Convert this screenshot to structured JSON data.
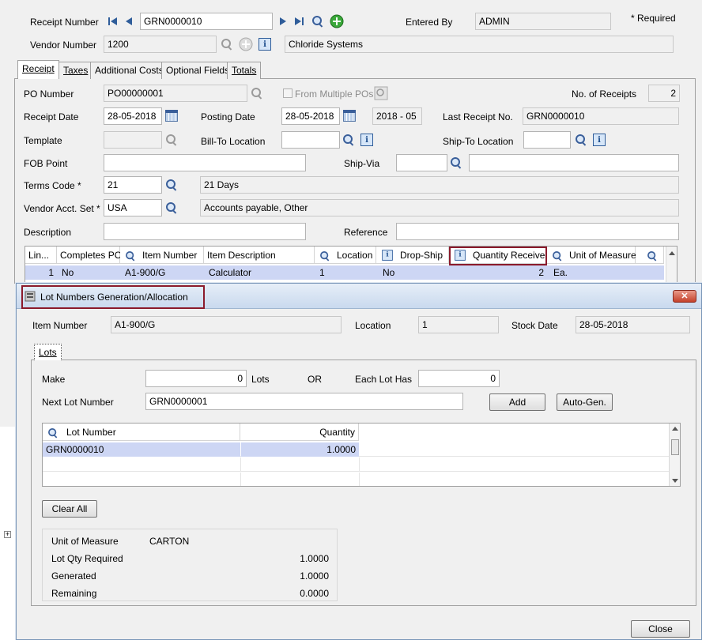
{
  "header": {
    "receipt_number_label": "Receipt Number",
    "receipt_number_value": "GRN0000010",
    "entered_by_label": "Entered By",
    "entered_by_value": "ADMIN",
    "required_note": "*  Required",
    "vendor_number_label": "Vendor Number",
    "vendor_number_value": "1200",
    "vendor_name_value": "Chloride Systems"
  },
  "tabs": [
    {
      "label": "Receipt",
      "active": true
    },
    {
      "label": "Taxes"
    },
    {
      "label": "Additional Costs"
    },
    {
      "label": "Optional Fields"
    },
    {
      "label": "Totals"
    }
  ],
  "receipt": {
    "po_number_label": "PO Number",
    "po_number_value": "PO00000001",
    "from_multiple_pos_label": "From Multiple POs",
    "no_of_receipts_label": "No. of Receipts",
    "no_of_receipts_value": "2",
    "receipt_date_label": "Receipt Date",
    "receipt_date_value": "28-05-2018",
    "posting_date_label": "Posting Date",
    "posting_date_value": "28-05-2018",
    "period_value": "2018 - 05",
    "last_receipt_no_label": "Last Receipt No.",
    "last_receipt_no_value": "GRN0000010",
    "template_label": "Template",
    "bill_to_label": "Bill-To Location",
    "ship_to_label": "Ship-To Location",
    "fob_label": "FOB Point",
    "ship_via_label": "Ship-Via",
    "terms_label": "Terms Code *",
    "terms_value": "21",
    "terms_desc": "21 Days",
    "vendor_acct_label": "Vendor Acct. Set *",
    "vendor_acct_value": "USA",
    "vendor_acct_desc": "Accounts payable, Other",
    "description_label": "Description",
    "reference_label": "Reference"
  },
  "lines_grid": {
    "headers": [
      "Lin...",
      "Completes PO",
      "Item Number",
      "Item Description",
      "Location",
      "Drop-Ship",
      "Quantity Received",
      "Unit of Measure"
    ],
    "rows": [
      {
        "line": "1",
        "completes_po": "No",
        "item_number": "A1-900/G",
        "item_description": "Calculator",
        "location": "1",
        "drop_ship": "No",
        "quantity_received": "2",
        "unit_of_measure": "Ea."
      }
    ]
  },
  "dialog": {
    "title": "Lot Numbers Generation/Allocation",
    "close_glyph": "✕",
    "item_number_label": "Item Number",
    "item_number_value": "A1-900/G",
    "location_label": "Location",
    "location_value": "1",
    "stock_date_label": "Stock Date",
    "stock_date_value": "28-05-2018",
    "tab_label": "Lots",
    "make_label": "Make",
    "make_value": "0",
    "lots_label": "Lots",
    "or_label": "OR",
    "each_lot_has_label": "Each Lot Has",
    "each_lot_has_value": "0",
    "next_lot_label": "Next Lot Number",
    "next_lot_value": "GRN0000001",
    "add_button": "Add",
    "autogen_button": "Auto-Gen.",
    "lot_grid": {
      "headers": [
        "Lot Number",
        "Quantity"
      ],
      "rows": [
        {
          "lot_number": "GRN0000010",
          "quantity": "1.0000"
        }
      ]
    },
    "clear_all_button": "Clear All",
    "summary": {
      "uom_label": "Unit of Measure",
      "uom_value": "CARTON",
      "lot_qty_required_label": "Lot Qty Required",
      "lot_qty_required_value": "1.0000",
      "generated_label": "Generated",
      "generated_value": "1.0000",
      "remaining_label": "Remaining",
      "remaining_value": "0.0000"
    },
    "close_button": "Close"
  },
  "colors": {
    "highlight_border": "#8b1a2b",
    "selected_row": "#cdd6f4",
    "accent": "#3a5f9a"
  }
}
